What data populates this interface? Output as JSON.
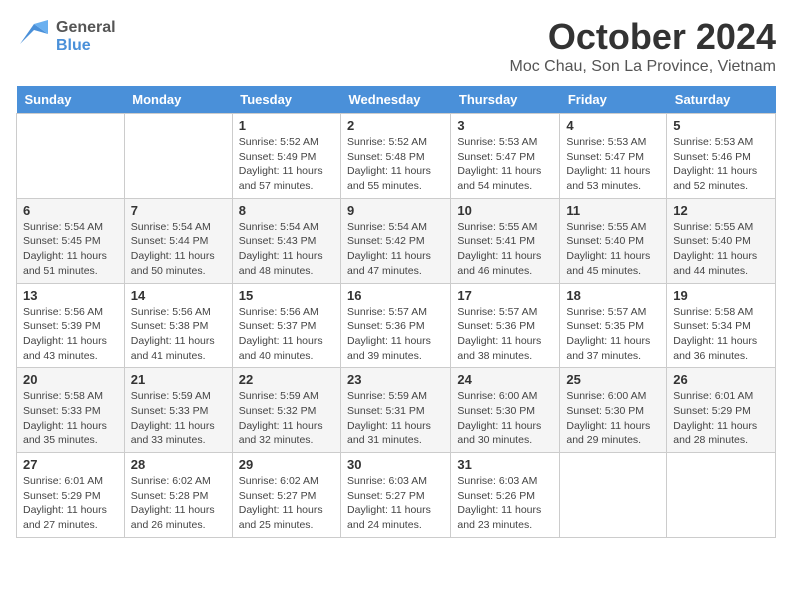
{
  "header": {
    "logo_general": "General",
    "logo_blue": "Blue",
    "month_title": "October 2024",
    "location": "Moc Chau, Son La Province, Vietnam"
  },
  "weekdays": [
    "Sunday",
    "Monday",
    "Tuesday",
    "Wednesday",
    "Thursday",
    "Friday",
    "Saturday"
  ],
  "weeks": [
    [
      {
        "day": "",
        "sunrise": "",
        "sunset": "",
        "daylight": ""
      },
      {
        "day": "",
        "sunrise": "",
        "sunset": "",
        "daylight": ""
      },
      {
        "day": "1",
        "sunrise": "Sunrise: 5:52 AM",
        "sunset": "Sunset: 5:49 PM",
        "daylight": "Daylight: 11 hours and 57 minutes."
      },
      {
        "day": "2",
        "sunrise": "Sunrise: 5:52 AM",
        "sunset": "Sunset: 5:48 PM",
        "daylight": "Daylight: 11 hours and 55 minutes."
      },
      {
        "day": "3",
        "sunrise": "Sunrise: 5:53 AM",
        "sunset": "Sunset: 5:47 PM",
        "daylight": "Daylight: 11 hours and 54 minutes."
      },
      {
        "day": "4",
        "sunrise": "Sunrise: 5:53 AM",
        "sunset": "Sunset: 5:47 PM",
        "daylight": "Daylight: 11 hours and 53 minutes."
      },
      {
        "day": "5",
        "sunrise": "Sunrise: 5:53 AM",
        "sunset": "Sunset: 5:46 PM",
        "daylight": "Daylight: 11 hours and 52 minutes."
      }
    ],
    [
      {
        "day": "6",
        "sunrise": "Sunrise: 5:54 AM",
        "sunset": "Sunset: 5:45 PM",
        "daylight": "Daylight: 11 hours and 51 minutes."
      },
      {
        "day": "7",
        "sunrise": "Sunrise: 5:54 AM",
        "sunset": "Sunset: 5:44 PM",
        "daylight": "Daylight: 11 hours and 50 minutes."
      },
      {
        "day": "8",
        "sunrise": "Sunrise: 5:54 AM",
        "sunset": "Sunset: 5:43 PM",
        "daylight": "Daylight: 11 hours and 48 minutes."
      },
      {
        "day": "9",
        "sunrise": "Sunrise: 5:54 AM",
        "sunset": "Sunset: 5:42 PM",
        "daylight": "Daylight: 11 hours and 47 minutes."
      },
      {
        "day": "10",
        "sunrise": "Sunrise: 5:55 AM",
        "sunset": "Sunset: 5:41 PM",
        "daylight": "Daylight: 11 hours and 46 minutes."
      },
      {
        "day": "11",
        "sunrise": "Sunrise: 5:55 AM",
        "sunset": "Sunset: 5:40 PM",
        "daylight": "Daylight: 11 hours and 45 minutes."
      },
      {
        "day": "12",
        "sunrise": "Sunrise: 5:55 AM",
        "sunset": "Sunset: 5:40 PM",
        "daylight": "Daylight: 11 hours and 44 minutes."
      }
    ],
    [
      {
        "day": "13",
        "sunrise": "Sunrise: 5:56 AM",
        "sunset": "Sunset: 5:39 PM",
        "daylight": "Daylight: 11 hours and 43 minutes."
      },
      {
        "day": "14",
        "sunrise": "Sunrise: 5:56 AM",
        "sunset": "Sunset: 5:38 PM",
        "daylight": "Daylight: 11 hours and 41 minutes."
      },
      {
        "day": "15",
        "sunrise": "Sunrise: 5:56 AM",
        "sunset": "Sunset: 5:37 PM",
        "daylight": "Daylight: 11 hours and 40 minutes."
      },
      {
        "day": "16",
        "sunrise": "Sunrise: 5:57 AM",
        "sunset": "Sunset: 5:36 PM",
        "daylight": "Daylight: 11 hours and 39 minutes."
      },
      {
        "day": "17",
        "sunrise": "Sunrise: 5:57 AM",
        "sunset": "Sunset: 5:36 PM",
        "daylight": "Daylight: 11 hours and 38 minutes."
      },
      {
        "day": "18",
        "sunrise": "Sunrise: 5:57 AM",
        "sunset": "Sunset: 5:35 PM",
        "daylight": "Daylight: 11 hours and 37 minutes."
      },
      {
        "day": "19",
        "sunrise": "Sunrise: 5:58 AM",
        "sunset": "Sunset: 5:34 PM",
        "daylight": "Daylight: 11 hours and 36 minutes."
      }
    ],
    [
      {
        "day": "20",
        "sunrise": "Sunrise: 5:58 AM",
        "sunset": "Sunset: 5:33 PM",
        "daylight": "Daylight: 11 hours and 35 minutes."
      },
      {
        "day": "21",
        "sunrise": "Sunrise: 5:59 AM",
        "sunset": "Sunset: 5:33 PM",
        "daylight": "Daylight: 11 hours and 33 minutes."
      },
      {
        "day": "22",
        "sunrise": "Sunrise: 5:59 AM",
        "sunset": "Sunset: 5:32 PM",
        "daylight": "Daylight: 11 hours and 32 minutes."
      },
      {
        "day": "23",
        "sunrise": "Sunrise: 5:59 AM",
        "sunset": "Sunset: 5:31 PM",
        "daylight": "Daylight: 11 hours and 31 minutes."
      },
      {
        "day": "24",
        "sunrise": "Sunrise: 6:00 AM",
        "sunset": "Sunset: 5:30 PM",
        "daylight": "Daylight: 11 hours and 30 minutes."
      },
      {
        "day": "25",
        "sunrise": "Sunrise: 6:00 AM",
        "sunset": "Sunset: 5:30 PM",
        "daylight": "Daylight: 11 hours and 29 minutes."
      },
      {
        "day": "26",
        "sunrise": "Sunrise: 6:01 AM",
        "sunset": "Sunset: 5:29 PM",
        "daylight": "Daylight: 11 hours and 28 minutes."
      }
    ],
    [
      {
        "day": "27",
        "sunrise": "Sunrise: 6:01 AM",
        "sunset": "Sunset: 5:29 PM",
        "daylight": "Daylight: 11 hours and 27 minutes."
      },
      {
        "day": "28",
        "sunrise": "Sunrise: 6:02 AM",
        "sunset": "Sunset: 5:28 PM",
        "daylight": "Daylight: 11 hours and 26 minutes."
      },
      {
        "day": "29",
        "sunrise": "Sunrise: 6:02 AM",
        "sunset": "Sunset: 5:27 PM",
        "daylight": "Daylight: 11 hours and 25 minutes."
      },
      {
        "day": "30",
        "sunrise": "Sunrise: 6:03 AM",
        "sunset": "Sunset: 5:27 PM",
        "daylight": "Daylight: 11 hours and 24 minutes."
      },
      {
        "day": "31",
        "sunrise": "Sunrise: 6:03 AM",
        "sunset": "Sunset: 5:26 PM",
        "daylight": "Daylight: 11 hours and 23 minutes."
      },
      {
        "day": "",
        "sunrise": "",
        "sunset": "",
        "daylight": ""
      },
      {
        "day": "",
        "sunrise": "",
        "sunset": "",
        "daylight": ""
      }
    ]
  ]
}
